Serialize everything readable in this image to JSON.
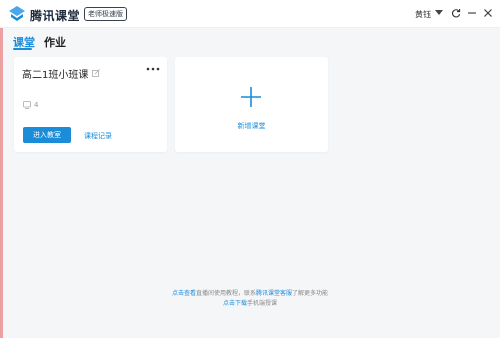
{
  "titlebar": {
    "app_title": "腾讯课堂",
    "edition_badge": "老师极速版",
    "user_name": "黄钰",
    "icons": [
      "logo-icon",
      "chevron-down-icon",
      "refresh-icon",
      "minimize-icon",
      "close-icon"
    ]
  },
  "tabs": [
    {
      "label": "课堂",
      "active": true
    },
    {
      "label": "作业",
      "active": false
    }
  ],
  "class_card": {
    "title": "高二1班小班课",
    "member_count": "4",
    "enter_button": "进入教室",
    "record_link": "课程记录"
  },
  "new_class_card": {
    "label": "新增课堂"
  },
  "footer": {
    "line1": {
      "link1": "点击查看",
      "text1": "直播间使用教程，联系",
      "link2": "腾讯课堂客服",
      "text2": "了解更多功能"
    },
    "line2": {
      "link": "点击下载",
      "text": "手机端授课"
    }
  },
  "colors": {
    "accent": "#1a8cd8",
    "background": "#f5f6f8",
    "card": "#ffffff"
  }
}
